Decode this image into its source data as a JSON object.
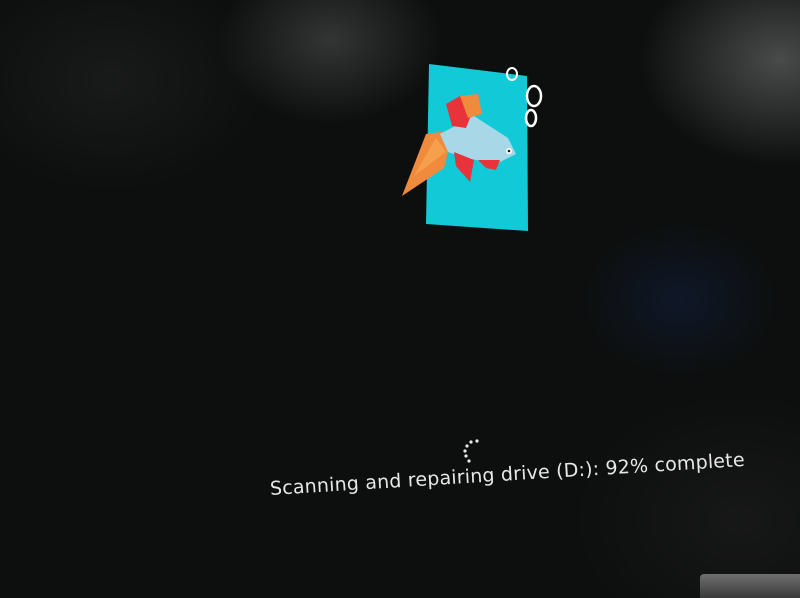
{
  "status": {
    "text": "Scanning and repairing drive (D:): 92% complete",
    "percent": 92
  },
  "logo": {
    "icon": "betta-fish-icon",
    "colors": {
      "tile": "#12c9d8",
      "fish_body": "#a8d8e8",
      "fin_orange": "#f08a3c",
      "fin_red": "#e8333a",
      "bubbles": "#ffffff"
    }
  },
  "spinner": {
    "icon": "loading-spinner-icon"
  }
}
